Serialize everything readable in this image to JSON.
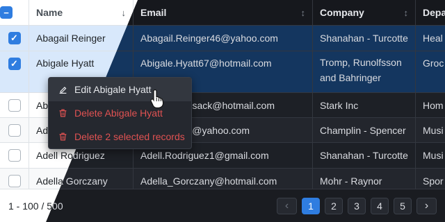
{
  "columns": [
    "Name",
    "Email",
    "Company",
    "Depa"
  ],
  "rows": [
    {
      "name": "Abagail Reinger",
      "email": "Abagail.Reinger46@yahoo.com",
      "company": "Shanahan - Turcotte",
      "dept": "Heal",
      "selected": true
    },
    {
      "name": "Abigale Hyatt",
      "email": "Abigale.Hyatt67@hotmail.com",
      "company_line1": "Tromp, Runolfsson",
      "company_line2": "and Bahringer",
      "dept": "Groc",
      "selected": true
    },
    {
      "name": "Ab",
      "email": "osack@hotmail.com",
      "company": "Stark Inc",
      "dept": "Hom",
      "selected": false
    },
    {
      "name": "Ad",
      "email": "9@yahoo.com",
      "company": "Champlin - Spencer",
      "dept": "Musi",
      "selected": false
    },
    {
      "name": "Adell Rodriguez",
      "email": "Adell.Rodriguez1@gmail.com",
      "company": "Shanahan - Turcotte",
      "dept": "Musi",
      "selected": false
    },
    {
      "name": "Adella Gorczany",
      "email": "Adella_Gorczany@hotmail.com",
      "company": "Mohr - Raynor",
      "dept": "Spor",
      "selected": false
    }
  ],
  "context_menu": {
    "edit": "Edit Abigale Hyatt",
    "delete": "Delete Abigale Hyatt",
    "delete_selected": "Delete 2 selected records"
  },
  "footer": {
    "range": "1 - 100 / 500",
    "pages": [
      "1",
      "2",
      "3",
      "4",
      "5"
    ],
    "prev": "‹",
    "next": "›"
  },
  "header_checkbox": "−",
  "checkmark": "✓",
  "sort_icon": "↓",
  "sort_both_icon": "↕",
  "colors": {
    "accent": "#2f7de0",
    "danger": "#e05252"
  }
}
